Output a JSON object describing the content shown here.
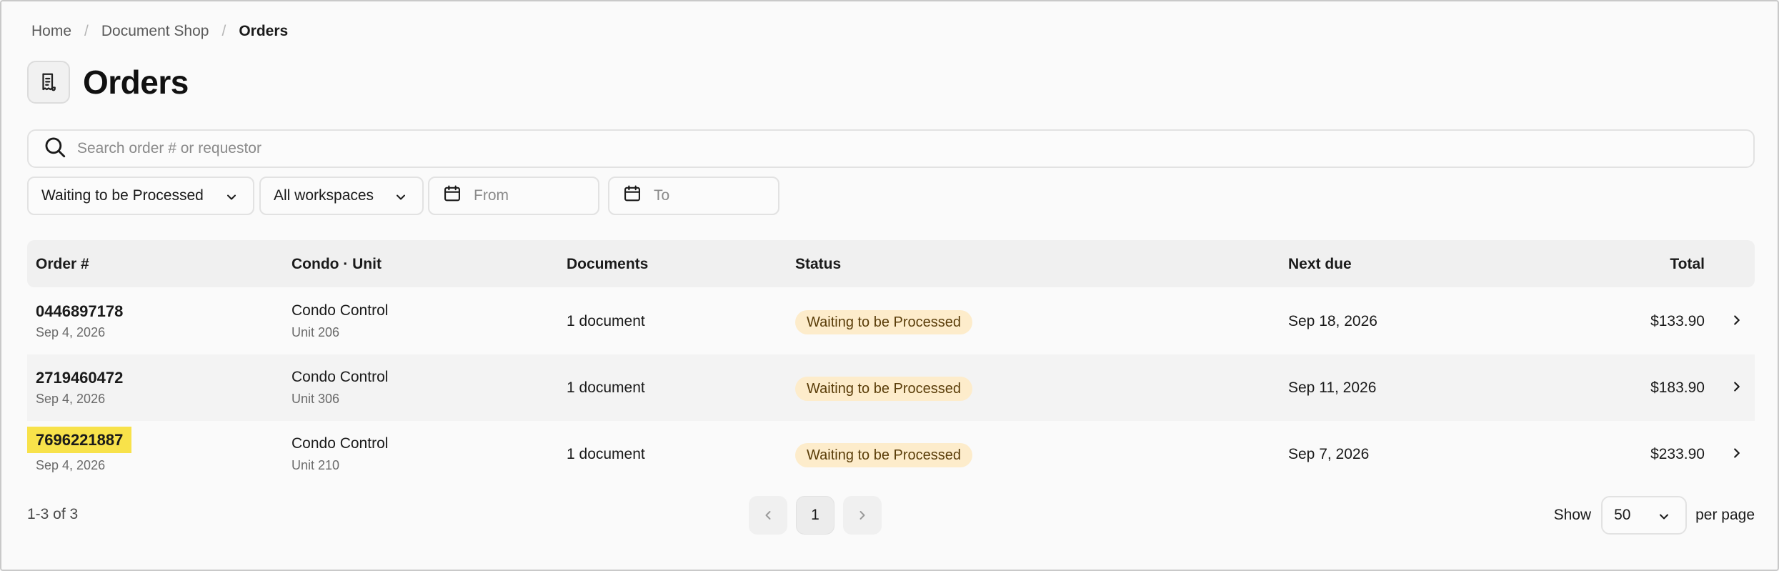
{
  "breadcrumb": {
    "home": "Home",
    "shop": "Document Shop",
    "current": "Orders",
    "separator": "/"
  },
  "header": {
    "title": "Orders",
    "icon": "receipt-icon"
  },
  "search": {
    "placeholder": "Search order # or requestor",
    "value": ""
  },
  "filters": {
    "status": "Waiting to be Processed",
    "workspace": "All workspaces",
    "from_placeholder": "From",
    "to_placeholder": "To"
  },
  "table": {
    "columns": [
      "Order #",
      "Condo · Unit",
      "Documents",
      "Status",
      "Next due",
      "Total"
    ],
    "rows": [
      {
        "order": "0446897178",
        "date": "Sep 4, 2026",
        "condo": "Condo Control",
        "unit": "Unit 206",
        "documents": "1 document",
        "status": "Waiting to be Processed",
        "next_due": "Sep 18, 2026",
        "total": "$133.90"
      },
      {
        "order": "2719460472",
        "date": "Sep 4, 2026",
        "condo": "Condo Control",
        "unit": "Unit 306",
        "documents": "1 document",
        "status": "Waiting to be Processed",
        "next_due": "Sep 11, 2026",
        "total": "$183.90"
      },
      {
        "order": "7696221887",
        "date": "Sep 4, 2026",
        "condo": "Condo Control",
        "unit": "Unit 210",
        "documents": "1 document",
        "status": "Waiting to be Processed",
        "next_due": "Sep 7, 2026",
        "total": "$233.90"
      }
    ]
  },
  "footer": {
    "count": "1-3 of 3",
    "page": "1",
    "show_label": "Show",
    "per_page_value": "50",
    "per_page_label": "per page"
  },
  "colors": {
    "badge_bg": "#fdeccb",
    "badge_text": "#5a3d09",
    "highlight": "#f8e24a"
  }
}
